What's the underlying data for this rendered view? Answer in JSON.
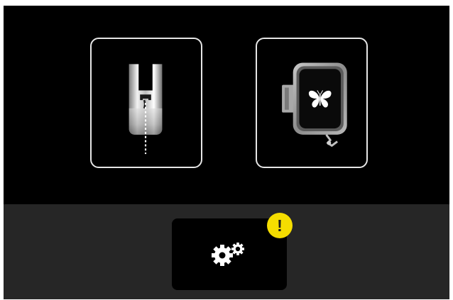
{
  "mode_select": {
    "tiles": [
      {
        "name": "sewing",
        "icon": "presser-foot-icon"
      },
      {
        "name": "embroidery",
        "icon": "embroidery-hoop-icon"
      }
    ]
  },
  "bottom_bar": {
    "settings_icon": "gears-icon",
    "alert": {
      "text": "!",
      "color": "#f5dd00"
    }
  },
  "colors": {
    "background": "#000000",
    "bar": "#262626",
    "tile_border": "#e6e6e6",
    "alert": "#f5dd00"
  }
}
